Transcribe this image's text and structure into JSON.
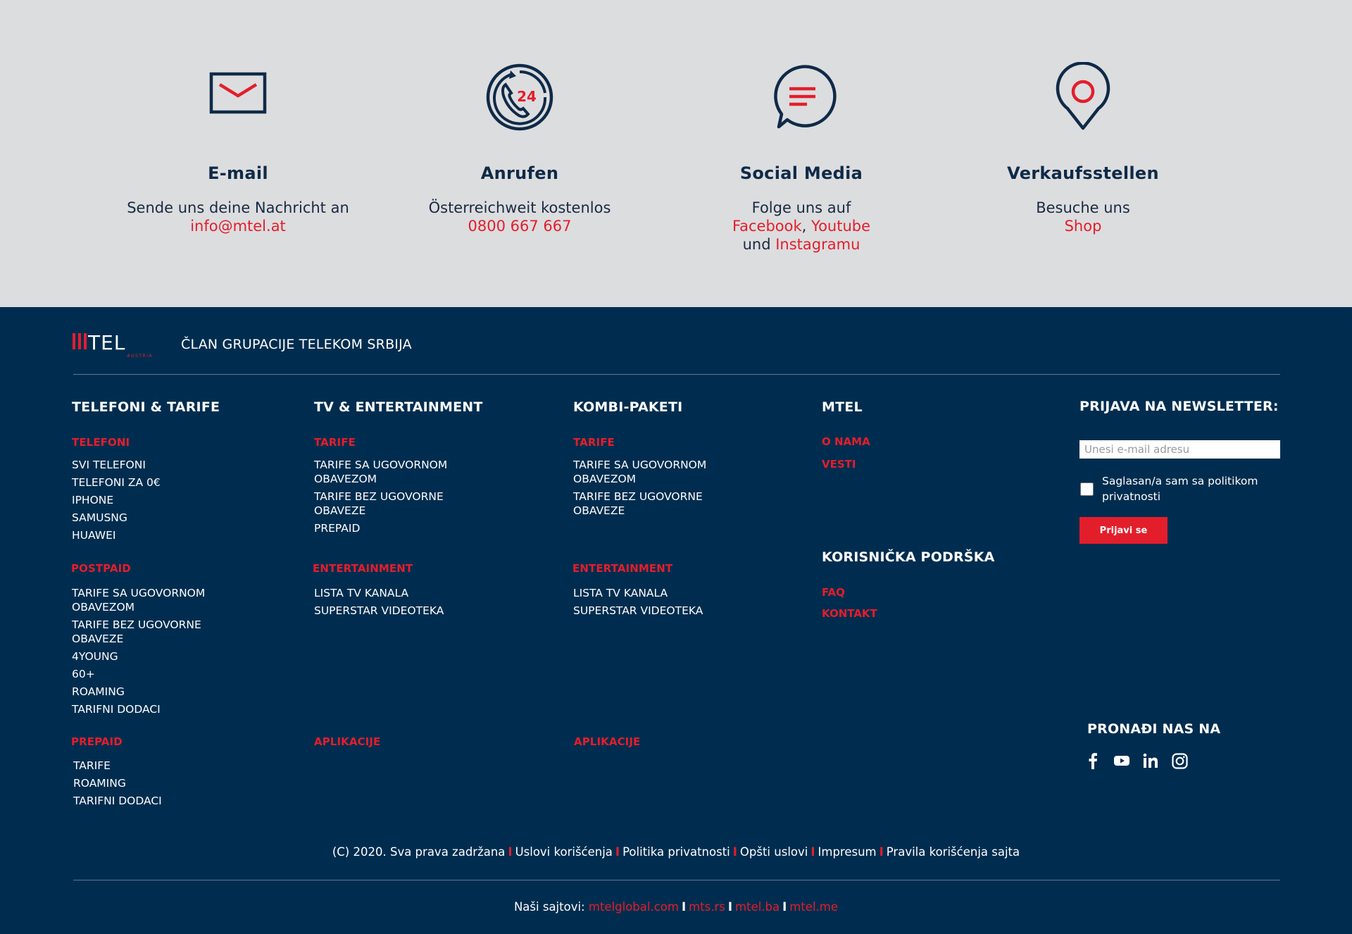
{
  "colors": {
    "navy": "#002d4f",
    "red": "#e31e2b",
    "grey": "#dcdddf",
    "ink": "#0f2a47"
  },
  "contact": [
    {
      "icon": "envelope-icon",
      "title": "E-mail",
      "line1": "Sende uns deine Nachricht an",
      "link1": "info@mtel.at"
    },
    {
      "icon": "phone-24-icon",
      "title": "Anrufen",
      "line1": "Österreichweit kostenlos",
      "link1": "0800 667 667"
    },
    {
      "icon": "chat-bubble-icon",
      "title": "Social Media",
      "line1": "Folge uns auf",
      "link1": "Facebook",
      "comma": ",",
      "link2": "Youtube",
      "and": "und",
      "link3": "Instagramu"
    },
    {
      "icon": "map-pin-icon",
      "title": "Verkaufsstellen",
      "line1": "Besuche uns",
      "link1": "Shop"
    }
  ],
  "brand": {
    "logo_text": "TEL",
    "logo_sub": "AUSTRIA",
    "member_text": "ČLAN GRUPACIJE TELEKOM SRBIJA"
  },
  "col1": {
    "title": "TELEFONI & TARIFE",
    "telefoni_h": "TELEFONI",
    "telefoni": [
      "SVI TELEFONI",
      "TELEFONI ZA 0€",
      "IPHONE",
      "SAMUSNG",
      "HUAWEI"
    ],
    "postpaid_h": "POSTPAID",
    "postpaid": [
      "TARIFE SA UGOVORNOM OBAVEZOM",
      "TARIFE BEZ UGOVORNE OBAVEZE",
      "4YOUNG",
      "60+",
      "ROAMING",
      "TARIFNI DODACI"
    ],
    "prepaid_h": "PREPAID",
    "prepaid": [
      "TARIFE",
      "ROAMING",
      "TARIFNI DODACI"
    ]
  },
  "col2": {
    "title": "TV & ENTERTAINMENT",
    "tarife_h": "TARIFE",
    "tarife": [
      "TARIFE SA UGOVORNOM OBAVEZOM",
      "TARIFE BEZ UGOVORNE OBAVEZE",
      "PREPAID"
    ],
    "ent_h": "ENTERTAINMENT",
    "ent": [
      "LISTA TV KANALA",
      "SUPERSTAR VIDEOTEKA"
    ],
    "apps_h": "APLIKACIJE"
  },
  "col3": {
    "title": "KOMBI-PAKETI",
    "tarife_h": "TARIFE",
    "tarife": [
      "TARIFE SA UGOVORNOM OBAVEZOM",
      "TARIFE BEZ UGOVORNE OBAVEZE"
    ],
    "ent_h": "ENTERTAINMENT",
    "ent": [
      "LISTA TV KANALA",
      "SUPERSTAR VIDEOTEKA"
    ],
    "apps_h": "APLIKACIJE"
  },
  "col4": {
    "title": "MTEL",
    "links": [
      "O NAMA",
      "VESTI"
    ],
    "support_title": "KORISNIČKA PODRŠKA",
    "support": [
      "FAQ",
      "KONTAKT"
    ]
  },
  "newsletter": {
    "title": "PRIJAVA NA NEWSLETTER:",
    "placeholder": "Unesi e-mail adresu",
    "consent": "Saglasan/a sam sa politikom privatnosti",
    "button": "Prijavi se",
    "find_us": "PRONAĐI NAS NA",
    "social_icons": [
      "facebook-icon",
      "youtube-icon",
      "linkedin-icon",
      "instagram-icon"
    ]
  },
  "legal": {
    "copyright": "(C) 2020. Sva prava zadržana",
    "sep": "I",
    "links": [
      "Uslovi korišćenja",
      "Politika privatnosti",
      "Opšti uslovi",
      "Impresum",
      "Pravila korišćenja sajta"
    ]
  },
  "sites": {
    "label": "Naši sajtovi:",
    "sep": "I",
    "links": [
      "mtelglobal.com",
      "mts.rs",
      "mtel.ba",
      "mtel.me"
    ]
  }
}
